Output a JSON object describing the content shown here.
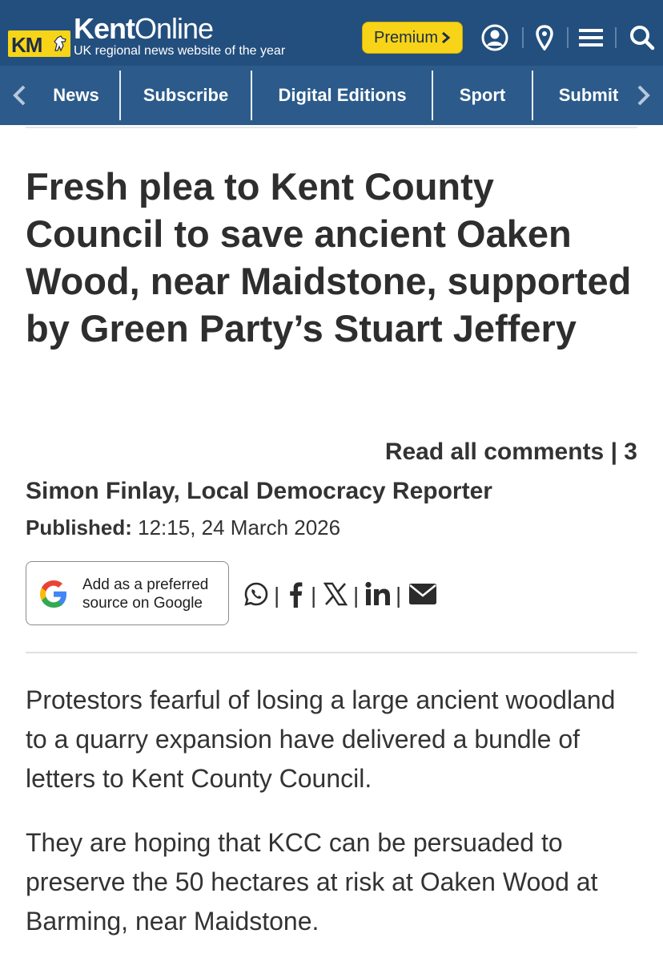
{
  "header": {
    "logo_text": "KM",
    "brand_bold": "Kent",
    "brand_light": "Online",
    "tagline": "UK regional news website of the year",
    "premium_label": "Premium",
    "icons": [
      "account-icon",
      "location-pin-icon",
      "menu-icon",
      "search-icon"
    ],
    "colors": {
      "header_bg": "#234f7e",
      "nav_bg": "#2c5b8b",
      "accent_yellow": "#f7d417"
    }
  },
  "nav": {
    "items": [
      {
        "label": "News"
      },
      {
        "label": "Subscribe"
      },
      {
        "label": "Digital Editions"
      },
      {
        "label": "Sport"
      },
      {
        "label": "Submit"
      }
    ]
  },
  "article": {
    "headline": "Fresh plea to Kent County Council to save ancient Oaken Wood, near Maidstone, supported by Green Party’s Stuart Jeffery",
    "comments_label": "Read all comments | 3",
    "byline": "Simon Finlay, Local Democracy Reporter",
    "published_label": "Published:",
    "published_value": "12:15, 24 March 2026",
    "google_source_line1": "Add as a preferred",
    "google_source_line2": "source on Google",
    "share_icons": [
      "whatsapp-icon",
      "facebook-icon",
      "x-icon",
      "linkedin-icon",
      "email-icon"
    ],
    "paragraphs": [
      "Protestors fearful of losing a large ancient woodland to a quarry expansion have delivered a bundle of letters to Kent County Council.",
      "They are hoping that KCC can be persuaded to preserve the 50 hectares at risk at Oaken Wood at Barming, near Maidstone."
    ]
  }
}
